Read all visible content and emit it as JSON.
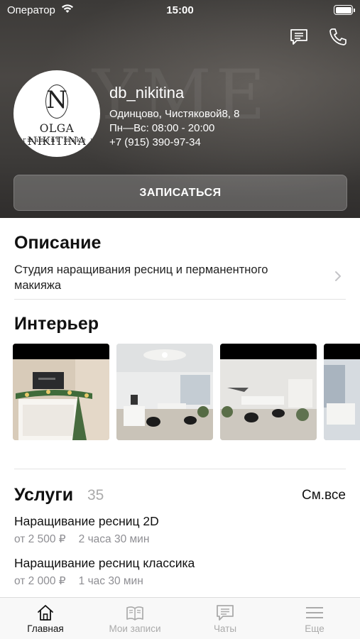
{
  "status_bar": {
    "carrier": "Оператор",
    "time": "15:00"
  },
  "profile": {
    "logo_letter": "N",
    "logo_name": "OLGA NIKITINA",
    "logo_sub": "ermanent make u",
    "name": "db_nikitina",
    "address": "Одинцово, Чистяковой8, 8",
    "hours": "Пн—Вс: 08:00 - 20:00",
    "phone": "+7 (915) 390-97-34"
  },
  "book_button": {
    "label": "ЗАПИСАТЬСЯ"
  },
  "description": {
    "title": "Описание",
    "text": "Студия наращивания ресниц и перманентного макияжа"
  },
  "interior": {
    "title": "Интерьер"
  },
  "services": {
    "title": "Услуги",
    "count": "35",
    "see_all": "См.все",
    "items": [
      {
        "name": "Наращивание ресниц 2D",
        "price": "от 2 500 ₽",
        "duration": "2 часа 30 мин"
      },
      {
        "name": "Наращивание ресниц классика",
        "price": "от 2 000 ₽",
        "duration": "1 час 30 мин"
      }
    ]
  },
  "tabs": [
    {
      "label": "Главная",
      "icon": "home-icon",
      "active": true
    },
    {
      "label": "Мои записи",
      "icon": "book-icon",
      "active": false
    },
    {
      "label": "Чаты",
      "icon": "chat-icon",
      "active": false
    },
    {
      "label": "Еще",
      "icon": "menu-icon",
      "active": false
    }
  ]
}
